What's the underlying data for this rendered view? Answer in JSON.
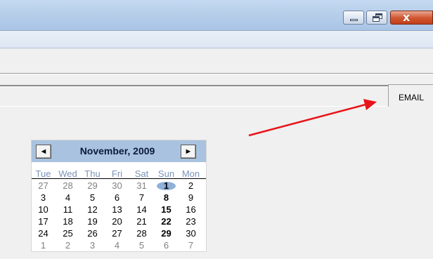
{
  "window": {
    "controls": {
      "minimize": "minimize-icon",
      "restore": "restore-icon",
      "close": "close-icon"
    }
  },
  "tab": {
    "label": "EMAIL"
  },
  "calendar": {
    "prev_label": "◄",
    "next_label": "►",
    "month_label": "November, 2009",
    "weekdays": [
      "Tue",
      "Wed",
      "Thu",
      "Fri",
      "Sat",
      "Sun",
      "Mon"
    ],
    "weeks": [
      [
        "27",
        "28",
        "29",
        "30",
        "31",
        "1",
        "2"
      ],
      [
        "3",
        "4",
        "5",
        "6",
        "7",
        "8",
        "9"
      ],
      [
        "10",
        "11",
        "12",
        "13",
        "14",
        "15",
        "16"
      ],
      [
        "17",
        "18",
        "19",
        "20",
        "21",
        "22",
        "23"
      ],
      [
        "24",
        "25",
        "26",
        "27",
        "28",
        "29",
        "30"
      ],
      [
        "1",
        "2",
        "3",
        "4",
        "5",
        "6",
        "7"
      ]
    ],
    "selected_day": "1",
    "colors": {
      "header": "#a9c2df",
      "weekday_text": "#7a93b9",
      "selection": "#8fb0d8"
    }
  },
  "annotation": {
    "arrow_color": "#e8141a"
  }
}
